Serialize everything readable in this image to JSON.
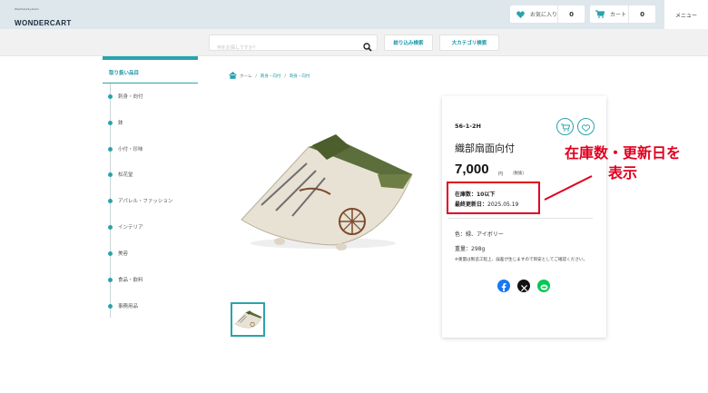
{
  "header": {
    "logo_sub": "WebSaleSystem",
    "logo_main": "WONDERCART",
    "favorite_label": "お気に入り",
    "favorite_count": "0",
    "cart_label": "カート",
    "cart_count": "0",
    "menu_label": "メニュー"
  },
  "search": {
    "placeholder": "何をお探しですか？",
    "filter_button": "絞り込み検索",
    "category_button": "大カテゴリ検索"
  },
  "sidebar": {
    "heading": "取り扱い品目",
    "items": [
      {
        "label": "刺身・向付"
      },
      {
        "label": "鉢"
      },
      {
        "label": "小付・珍味"
      },
      {
        "label": "松花堂"
      },
      {
        "label": "アパレル・ファッション"
      },
      {
        "label": "インテリア"
      },
      {
        "label": "美容"
      },
      {
        "label": "食品・飲料"
      },
      {
        "label": "事務用品"
      }
    ]
  },
  "breadcrumb": {
    "items": [
      "ホーム",
      "刺身・向付",
      "刺身・向付"
    ]
  },
  "product": {
    "code": "56-1-2H",
    "name": "織部扇面向付",
    "price": "7,000",
    "currency": "円",
    "tax": "（税抜）",
    "stock": "在庫数：10以下",
    "updated_label": "最終更新日：",
    "updated_date": "2025.05.19",
    "color": "色：緑、アイボリー",
    "weight": "重量：298g",
    "note": "※重量は製造工程上、誤差が生じますので目安としてご確認ください。"
  },
  "icons": {
    "home": "home-icon",
    "search": "search-icon",
    "heart": "heart-icon",
    "cart": "cart-icon",
    "share_facebook": "facebook-icon",
    "share_x": "x-icon",
    "share_line": "line-icon"
  },
  "colors": {
    "accent": "#2aa3ad",
    "annotation": "#e1001e",
    "facebook": "#1877f2",
    "line": "#06c755"
  },
  "annotation": {
    "line1": "在庫数・更新日を",
    "line2": "表示"
  }
}
